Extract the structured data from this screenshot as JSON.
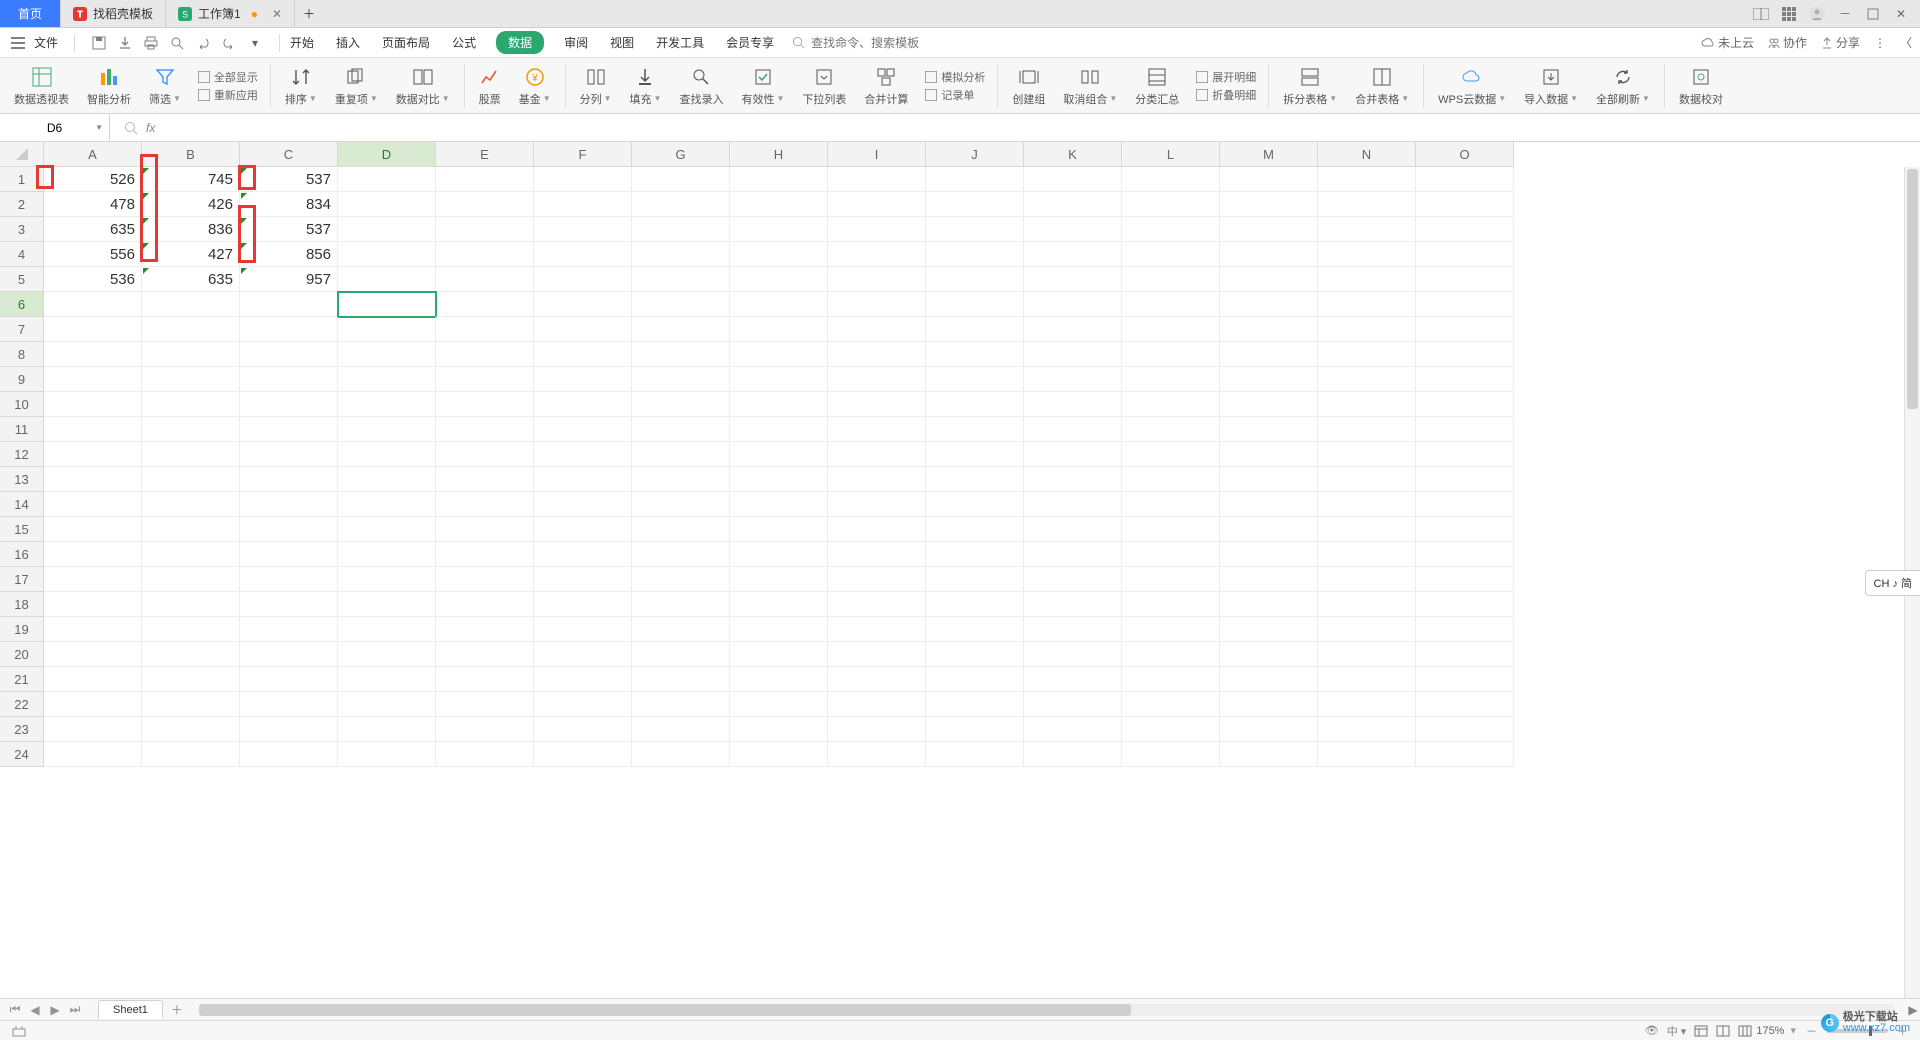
{
  "titlebar": {
    "home": "首页",
    "tabs": [
      {
        "icon_color": "#e53935",
        "label": "找稻壳模板"
      },
      {
        "icon_color": "#2aa870",
        "label": "工作簿1",
        "modified": true
      }
    ],
    "layout_icon": "layout",
    "grid_icon": "grid",
    "avatar_icon": "avatar"
  },
  "menubar": {
    "file": "文件",
    "qat": [
      "save",
      "save-as",
      "print",
      "print-preview",
      "undo",
      "redo"
    ],
    "items": [
      "开始",
      "插入",
      "页面布局",
      "公式",
      "数据",
      "审阅",
      "视图",
      "开发工具",
      "会员专享"
    ],
    "active_index": 4,
    "search_placeholder": "查找命令、搜索模板",
    "search_icon": "search",
    "right": {
      "cloud": "未上云",
      "collab": "协作",
      "share": "分享"
    }
  },
  "ribbon": {
    "items": [
      {
        "id": "pivot",
        "label": "数据透视表"
      },
      {
        "id": "smart",
        "label": "智能分析"
      },
      {
        "id": "filter",
        "label": "筛选",
        "dd": true
      },
      {
        "id": "showall",
        "label": "全部显示",
        "row": true
      },
      {
        "id": "reapply",
        "label": "重新应用",
        "row": true
      },
      {
        "id": "sort",
        "label": "排序",
        "dd": true
      },
      {
        "id": "dup",
        "label": "重复项",
        "dd": true
      },
      {
        "id": "compare",
        "label": "数据对比",
        "dd": true
      },
      {
        "id": "stock",
        "label": "股票"
      },
      {
        "id": "fund",
        "label": "基金",
        "dd": true
      },
      {
        "id": "split",
        "label": "分列",
        "dd": true
      },
      {
        "id": "fill",
        "label": "填充",
        "dd": true
      },
      {
        "id": "find",
        "label": "查找录入"
      },
      {
        "id": "validate",
        "label": "有效性",
        "dd": true
      },
      {
        "id": "dropdown",
        "label": "下拉列表"
      },
      {
        "id": "consol",
        "label": "合并计算"
      },
      {
        "id": "simul",
        "label": "模拟分析",
        "row": true
      },
      {
        "id": "form",
        "label": "记录单",
        "row": true
      },
      {
        "id": "group",
        "label": "创建组"
      },
      {
        "id": "ungroup",
        "label": "取消组合",
        "dd": true
      },
      {
        "id": "subtotal",
        "label": "分类汇总"
      },
      {
        "id": "expand",
        "label": "展开明细",
        "row": true,
        "disabled": true
      },
      {
        "id": "collapse",
        "label": "折叠明细",
        "row": true,
        "disabled": true
      },
      {
        "id": "splittbl",
        "label": "拆分表格",
        "dd": true
      },
      {
        "id": "mergetbl",
        "label": "合并表格",
        "dd": true
      },
      {
        "id": "wpscloud",
        "label": "WPS云数据",
        "dd": true
      },
      {
        "id": "import",
        "label": "导入数据",
        "dd": true
      },
      {
        "id": "refresh",
        "label": "全部刷新",
        "dd": true
      },
      {
        "id": "verify",
        "label": "数据校对"
      }
    ]
  },
  "namebox": {
    "value": "D6",
    "fx": "fx"
  },
  "columns": [
    "A",
    "B",
    "C",
    "D",
    "E",
    "F",
    "G",
    "H",
    "I",
    "J",
    "K",
    "L",
    "M",
    "N",
    "O"
  ],
  "rows": 24,
  "selected": {
    "col": "D",
    "row": 6
  },
  "data": {
    "A1": "526",
    "B1": "745",
    "C1": "537",
    "A2": "478",
    "B2": "426",
    "C2": "834",
    "A3": "635",
    "B3": "836",
    "C3": "537",
    "A4": "556",
    "B4": "427",
    "C4": "856",
    "A5": "536",
    "B5": "635",
    "C5": "957"
  },
  "text_marks": {
    "B1": true,
    "B2": true,
    "B3": true,
    "B4": true,
    "B5": true,
    "C1": true,
    "C2": true,
    "C3": true,
    "C4": true,
    "C5": true
  },
  "sheets": {
    "active": "Sheet1"
  },
  "status": {
    "zoom": "175%",
    "views": [
      "normal",
      "page-layout",
      "page-break"
    ]
  },
  "side_chip": "CH ♪ 简",
  "watermark": {
    "brand": "极光下载站",
    "url": "www.xz7.com"
  }
}
